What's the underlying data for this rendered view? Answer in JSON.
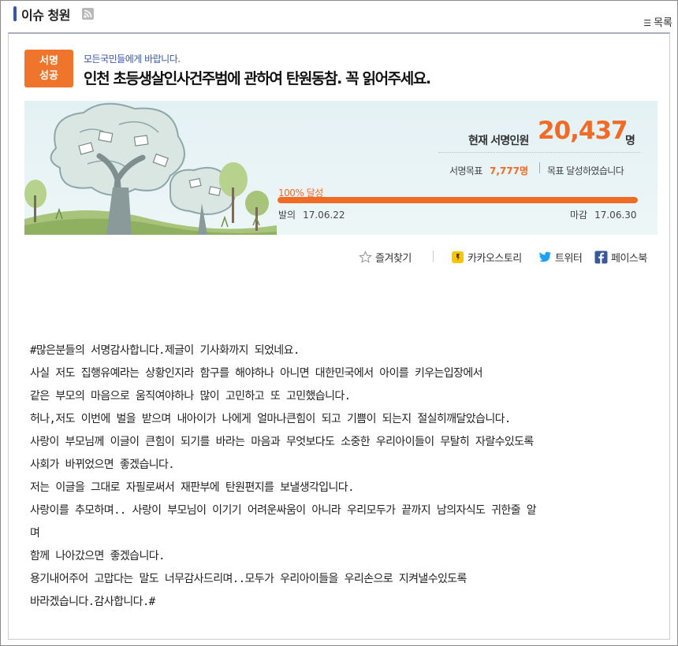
{
  "header": {
    "title": "이슈 청원",
    "rss_icon": "rss-icon",
    "list_icon": "list-icon",
    "list_label": "목록"
  },
  "petition": {
    "badge_line1": "서명",
    "badge_line2": "성공",
    "subtitle": "모든국민들에게 바랍니다.",
    "title": "인천 초등생살인사건주범에 관하여 탄원동참. 꼭 읽어주세요."
  },
  "stats": {
    "current_label": "현재 서명인원",
    "current_count": "20,437",
    "current_unit": "명",
    "goal_label": "서명목표",
    "goal_value": "7,777명",
    "goal_status": "목표 달성하였습니다",
    "progress_label": "100% 달성",
    "progress_value": 1.0,
    "start_label": "발의",
    "start_date": "17.06.22",
    "end_label": "마감",
    "end_date": "17.06.30"
  },
  "share": {
    "favorite": "즐겨찾기",
    "kakao": "카카오스토리",
    "twitter": "트위터",
    "facebook": "페이스북"
  },
  "body_lines": [
    " #많은분들의 서명감사합니다.제글이 기사화까지 되었네요.",
    "사실 저도 집행유예라는 상황인지라 함구를 해야하나 아니면 대한민국에서 아이를 키우는입장에서",
    "같은 부모의 마음으로 움직여야하나 많이 고민하고 또 고민했습니다.",
    "허나,저도 이번에 벌을 받으며 내아이가 나에게 얼마나큰힘이 되고 기쁨이 되는지 절실히깨달았습니다.",
    "사랑이 부모님께 이글이 큰힘이 되기를 바라는 마음과 무엇보다도 소중한 우리아이들이 무탈히 자랄수있도록",
    "사회가 바뀌었으면 좋겠습니다.",
    "저는 이글을 그대로 자필로써서 재판부에 탄원편지를 보낼생각입니다.",
    "사랑이를 추모하며.. 사랑이 부모님이 이기기 어려운싸움이 아니라 우리모두가 끝까지 남의자식도 귀한줄 알",
    "며",
    "함께 나아갔으면 좋겠습니다.",
    "용기내어주어 고맙다는 말도 너무감사드리며..모두가 우리아이들을 우리손으로 지켜낼수있도록",
    "바라겠습니다.감사합니다.#"
  ],
  "colors": {
    "accent_orange": "#f06b26",
    "link_blue": "#3a55a5",
    "banner_bg": "#e4f1f4"
  }
}
